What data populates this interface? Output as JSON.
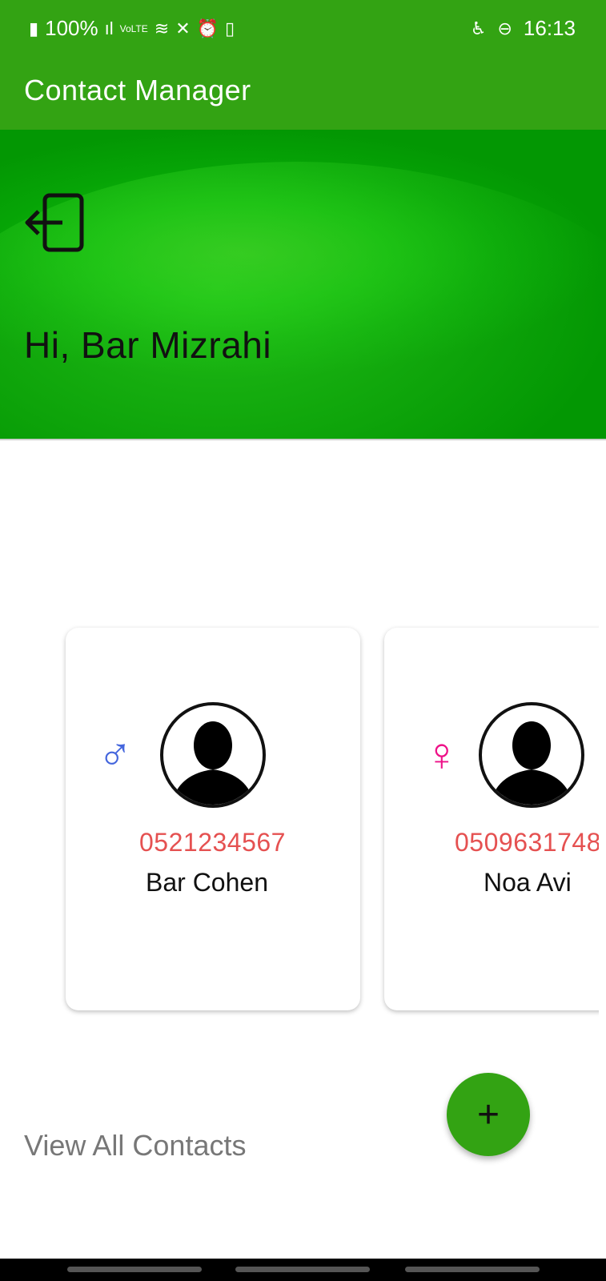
{
  "status_bar": {
    "battery": "100%",
    "time": "16:13",
    "left_icons": [
      "battery-icon",
      "signal-icon",
      "volte-icon",
      "wifi-icon",
      "mute-icon",
      "alarm-icon",
      "battery-saver-icon"
    ],
    "right_icons": [
      "accessibility-icon",
      "dnd-icon"
    ]
  },
  "app_bar": {
    "title": "Contact Manager"
  },
  "header": {
    "greeting": "Hi, Bar Mizrahi"
  },
  "contacts": [
    {
      "phone": "0521234567",
      "name": "Bar Cohen",
      "gender_symbol": "♂",
      "gender_color": "#4466dd"
    },
    {
      "phone": "0509631748",
      "name": "Noa Avi",
      "gender_symbol": "♀",
      "gender_color": "#ee1188"
    }
  ],
  "view_all_label": "View All Contacts",
  "fab_label": "+",
  "colors": {
    "primary": "#33a313",
    "phone": "#e55151"
  }
}
